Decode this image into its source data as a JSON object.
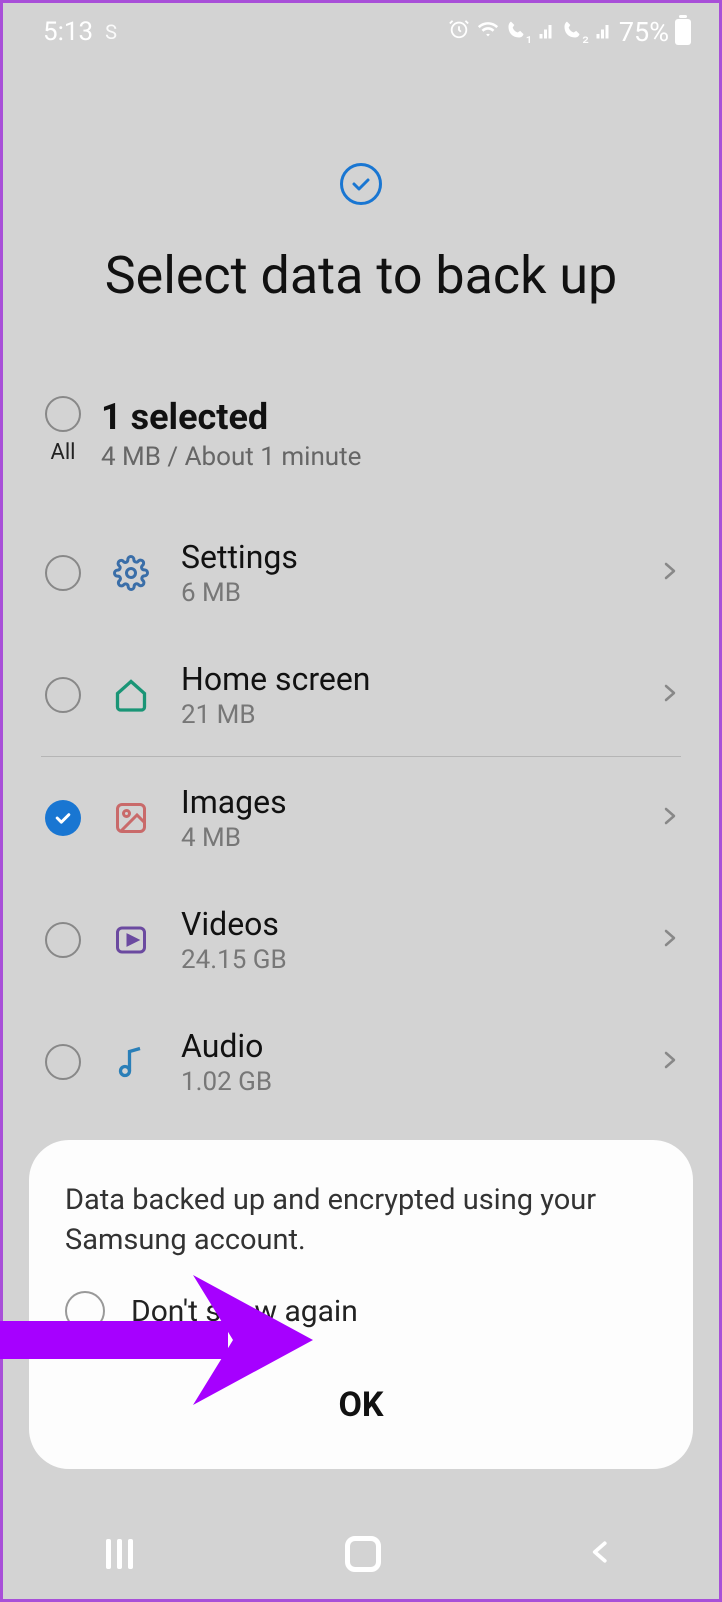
{
  "status": {
    "time": "5:13",
    "carrier_indicator": "S",
    "battery_pct": "75%"
  },
  "header": {
    "title": "Select data to back up"
  },
  "summary": {
    "all_label": "All",
    "selected_count": "1 selected",
    "subtitle": "4 MB / About 1 minute"
  },
  "items": [
    {
      "title": "Settings",
      "size": "6 MB",
      "checked": false,
      "icon": "gear",
      "divider_after": false
    },
    {
      "title": "Home screen",
      "size": "21 MB",
      "checked": false,
      "icon": "home",
      "divider_after": true
    },
    {
      "title": "Images",
      "size": "4 MB",
      "checked": true,
      "icon": "image",
      "divider_after": false
    },
    {
      "title": "Videos",
      "size": "24.15 GB",
      "checked": false,
      "icon": "video",
      "divider_after": false
    },
    {
      "title": "Audio",
      "size": "1.02 GB",
      "checked": false,
      "icon": "audio",
      "divider_after": false
    }
  ],
  "popup": {
    "message": "Data backed up and encrypted using your Samsung account.",
    "dont_show_label": "Don't show again",
    "ok_label": "OK"
  },
  "annotation": {
    "arrow_color": "#a600ff"
  }
}
